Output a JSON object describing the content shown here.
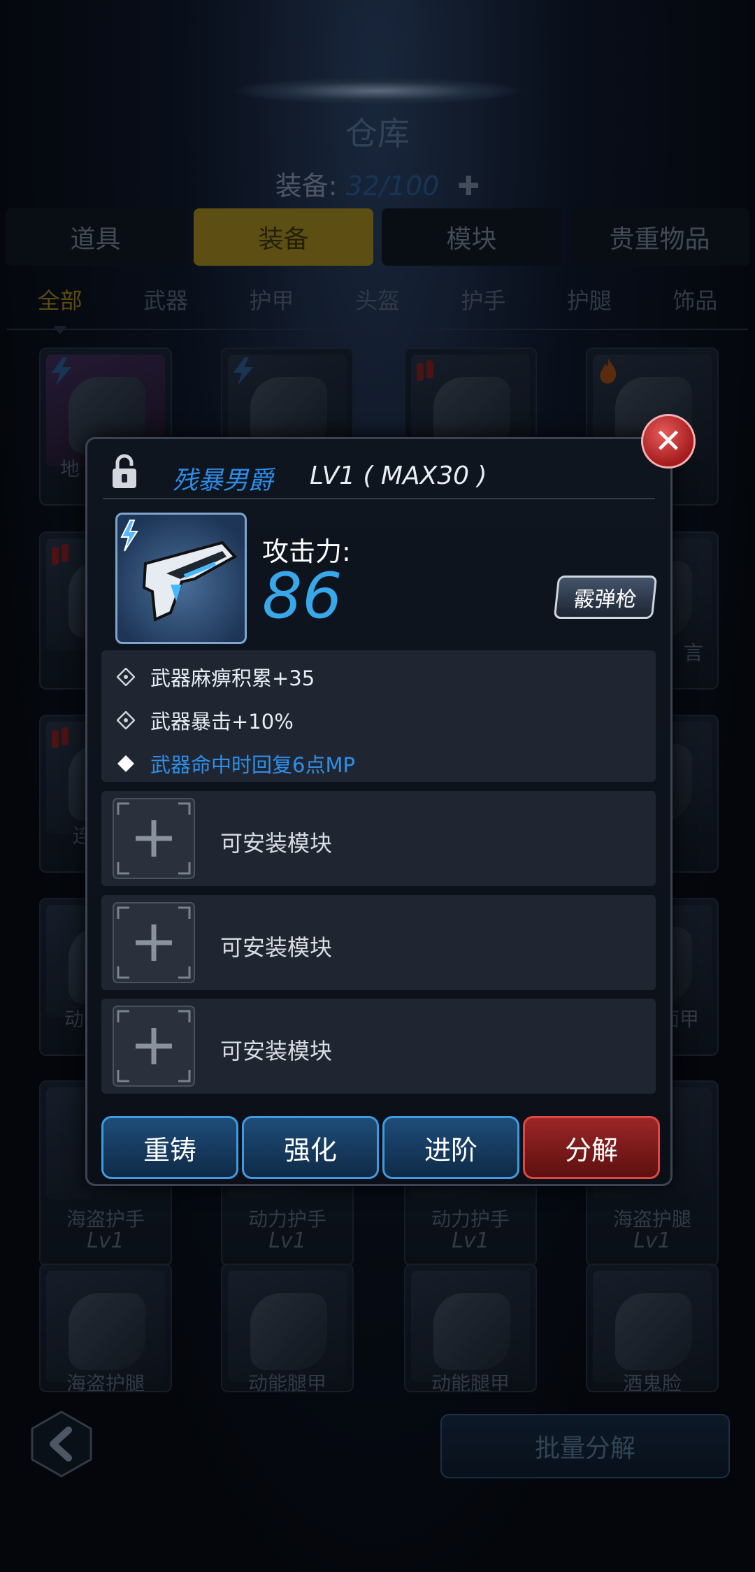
{
  "warehouse": {
    "title": "仓库",
    "capacity_label": "装备:",
    "capacity_value": "32/100",
    "tabs": [
      "道具",
      "装备",
      "模块",
      "贵重物品"
    ],
    "active_tab": "装备",
    "subtabs": [
      "全部",
      "武器",
      "护甲",
      "头盔",
      "护手",
      "护腿",
      "饰品"
    ],
    "active_subtab": "全部"
  },
  "grid": {
    "row1": [
      "地",
      "",
      "",
      "头"
    ],
    "row2": [
      "",
      "",
      "",
      "言"
    ],
    "row3": [
      "连",
      "",
      "",
      ""
    ],
    "row4": [
      "动",
      "",
      "",
      "面甲"
    ],
    "row5": [
      {
        "name": "海盗护手",
        "level": "Lv1"
      },
      {
        "name": "动力护手",
        "level": "Lv1"
      },
      {
        "name": "动力护手",
        "level": "Lv1"
      },
      {
        "name": "海盗护腿",
        "level": "Lv1"
      }
    ],
    "row6": [
      "海盗护腿",
      "动能腿甲",
      "动能腿甲",
      "酒鬼脸"
    ]
  },
  "detail": {
    "weapon_name": "残暴男爵",
    "level_text": "LV1 ( MAX30 )",
    "attack_label": "攻击力:",
    "attack_value": "86",
    "weapon_type": "霰弹枪",
    "stats": [
      {
        "text": "武器麻痹积累+35",
        "highlight": false
      },
      {
        "text": "武器暴击+10%",
        "highlight": false
      },
      {
        "text": "武器命中时回复6点MP",
        "highlight": true
      }
    ],
    "module_slots": [
      "可安装模块",
      "可安装模块",
      "可安装模块"
    ],
    "actions": {
      "recast": "重铸",
      "enhance": "强化",
      "advance": "进阶",
      "dismantle": "分解"
    }
  },
  "footer": {
    "bulk_dismantle": "批量分解"
  },
  "colors": {
    "accent_blue": "#2c8de8",
    "attack_blue": "#38a8ea",
    "gold_tab": "#6e5d17",
    "danger_red": "#a51c1c"
  }
}
